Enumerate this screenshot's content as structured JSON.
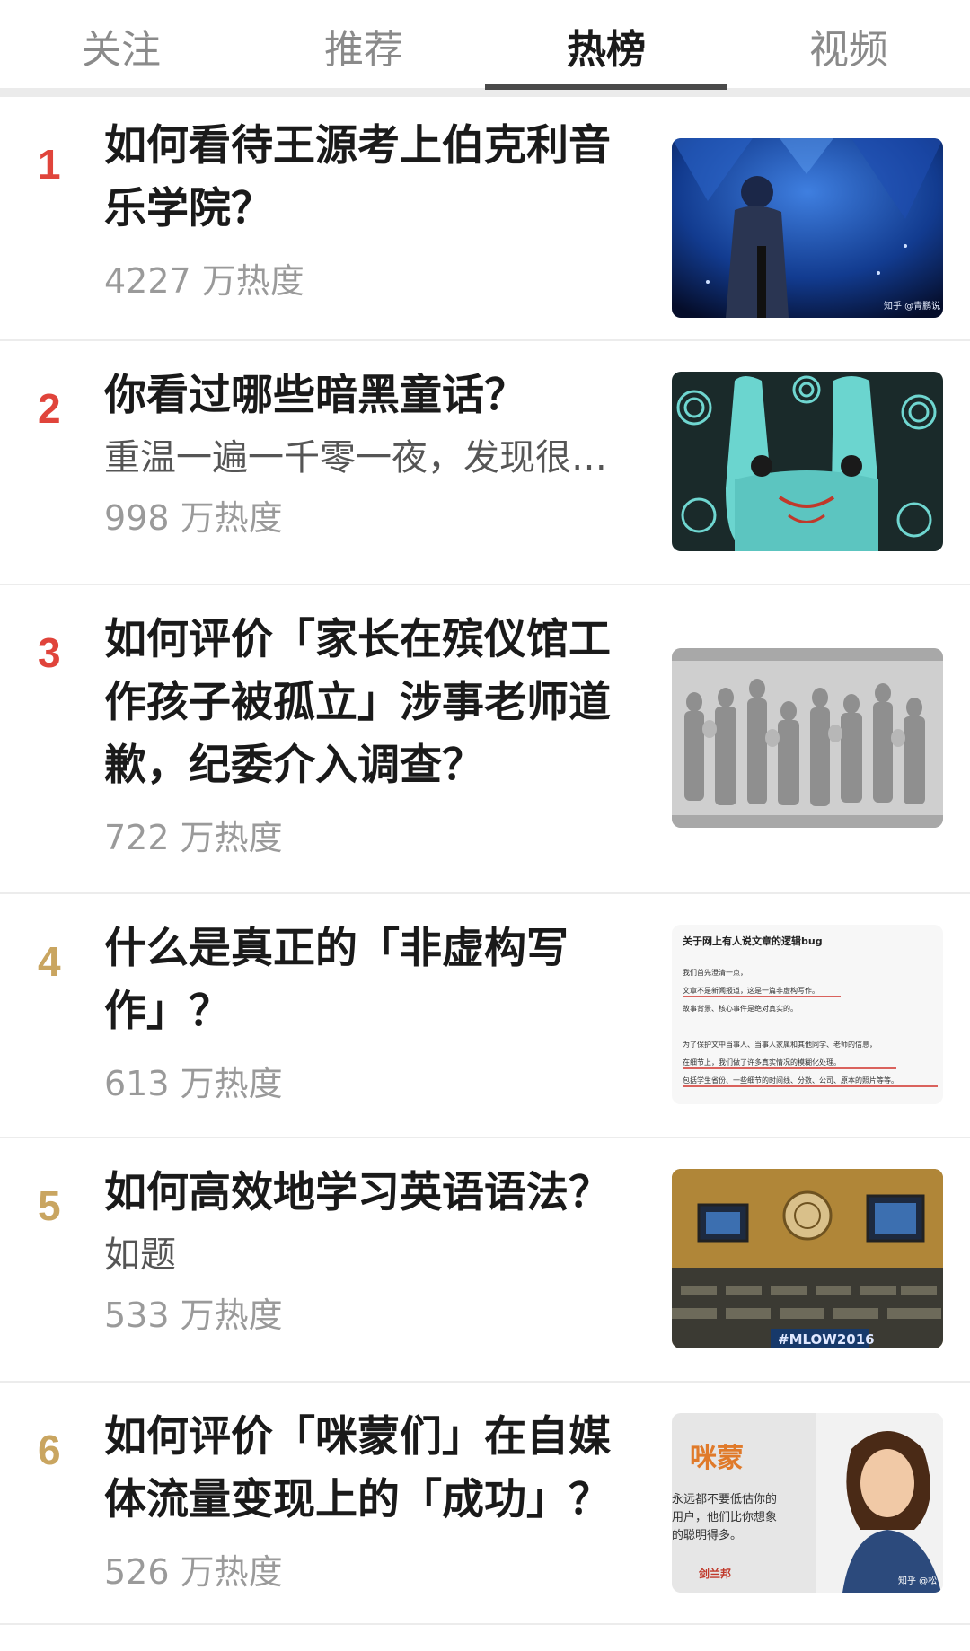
{
  "tabs": [
    {
      "label": "关注"
    },
    {
      "label": "推荐"
    },
    {
      "label": "热榜"
    },
    {
      "label": "视频"
    }
  ],
  "colors": {
    "rank_top": "#e0443b",
    "rank_other": "#c9a560",
    "accent_underline": "#4a4a4a"
  },
  "items": [
    {
      "rank": "1",
      "title": "如何看待王源考上伯克利音乐学院？",
      "excerpt": "",
      "heat": "4227 万热度",
      "image": "concert-photo",
      "image_watermark": "知乎 @青鹏说"
    },
    {
      "rank": "2",
      "title": "你看过哪些暗黑童话？",
      "excerpt": "重温一遍一千零一夜，发现很…",
      "heat": "998 万热度",
      "image": "dark-bunny-illustration",
      "image_watermark": ""
    },
    {
      "rank": "3",
      "title": "如何评价「家长在殡仪馆工作孩子被孤立」涉事老师道歉，纪委介入调查？",
      "excerpt": "",
      "heat": "722 万热度",
      "image": "stone-relief-sculpture",
      "image_watermark": ""
    },
    {
      "rank": "4",
      "title": "什么是真正的「非虚构写作」？",
      "excerpt": "",
      "heat": "613 万热度",
      "image": "text-screenshot",
      "image_watermark": "",
      "image_text": {
        "heading": "关于网上有人说文章的逻辑bug",
        "lines": [
          "我们首先澄清一点，",
          "文章不是新闻报道，这是一篇非虚构写作。",
          "故事背景、核心事件是绝对真实的。",
          "为了保护文中当事人、当事人家属和其他同学、老师的信息，",
          "在细节上，我们做了许多真实情况的模糊化处理。",
          "包括学生省份、一些细节的时间线、分数、公司、原本的照片等等。"
        ]
      }
    },
    {
      "rank": "5",
      "title": "如何高效地学习英语语法？",
      "excerpt": "如题",
      "heat": "533 万热度",
      "image": "un-assembly-hall",
      "image_watermark": "",
      "image_banner": "#MLOW2016"
    },
    {
      "rank": "6",
      "title": "如何评价「咪蒙们」在自媒体流量变现上的「成功」？",
      "excerpt": "",
      "heat": "526 万热度",
      "image": "portrait-poster",
      "image_watermark": "知乎 @松",
      "image_text": {
        "brand": "咪蒙",
        "lines": [
          "永远都不要低估你的",
          "用户，他们比你想象",
          "的聪明得多。"
        ],
        "footer": "剑兰邦"
      }
    }
  ]
}
